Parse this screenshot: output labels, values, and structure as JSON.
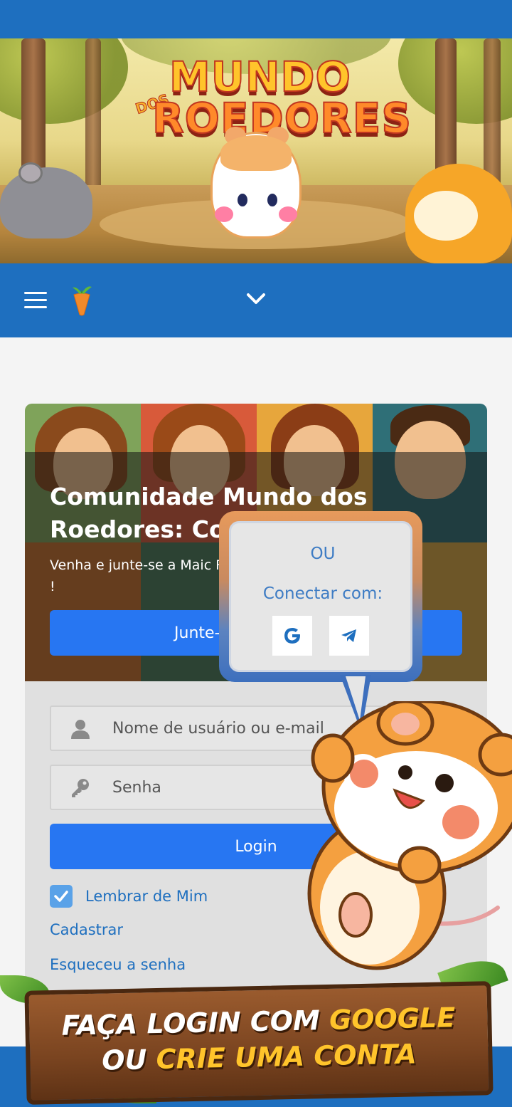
{
  "banner": {
    "logo_small": "DOS",
    "logo_line1": "MUNDO",
    "logo_line2": "ROEDORES"
  },
  "nav": {
    "menu_icon": "hamburger-icon",
    "logo_icon": "carrot-logo-icon",
    "toggle_icon": "chevron-down-icon"
  },
  "hero": {
    "title": "Comunidade Mundo dos Roedores: Co",
    "subtitle": "Venha e junte-se a Maic Roedores do Brasil !",
    "join_button": "Junte-se a"
  },
  "bubble": {
    "or_label": "OU",
    "connect_label": "Conectar com:",
    "social": [
      "google-icon",
      "telegram-icon"
    ]
  },
  "login": {
    "username_placeholder": "Nome de usuário ou e-mail",
    "password_placeholder": "Senha",
    "login_button": "Login",
    "remember_me": "Lembrar de Mim",
    "register_link": "Cadastrar",
    "forgot_link": "Esqueceu a senha"
  },
  "promo": {
    "line1_white": "FAÇA LOGIN COM ",
    "line1_yellow": "GOOGLE",
    "line2_white": "OU ",
    "line2_yellow": "CRIE UMA CONTA"
  },
  "colors": {
    "brand_blue": "#1e6fbf",
    "button_blue": "#2776f2",
    "highlight_yellow": "#ffc42b"
  }
}
